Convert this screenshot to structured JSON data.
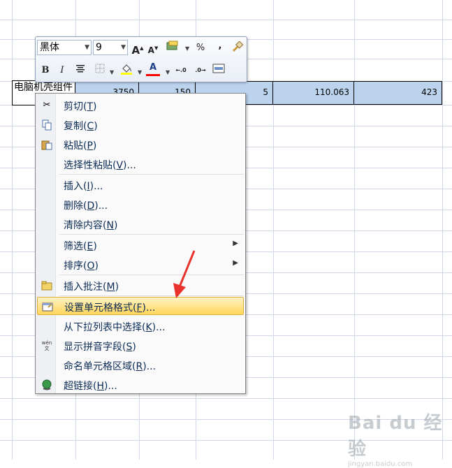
{
  "toolbar": {
    "font_name": "黑体",
    "font_size": "9",
    "icons": [
      "grow-font-icon",
      "shrink-font-icon",
      "number-format-icon",
      "percent-icon",
      "comma-style-icon",
      "format-painter-icon",
      "bold-icon",
      "italic-icon",
      "center-align-icon",
      "borders-icon",
      "fill-color-icon",
      "font-color-icon",
      "increase-decimal-icon",
      "decrease-decimal-icon",
      "merge-center-icon"
    ],
    "percent_label": "%",
    "comma_label": ",",
    "bold_label": "B",
    "italic_label": "I",
    "font_color_label": "A",
    "grow_label": "A",
    "shrink_label": "A",
    "colors": {
      "fill": "#ffff00",
      "font": "#ff0000"
    }
  },
  "row": {
    "name_cell": "电脑机壳组件",
    "values": [
      "3750",
      "150",
      "5",
      "110.063",
      "423"
    ]
  },
  "menu": {
    "items": [
      {
        "text": "剪切(",
        "key": "T",
        "tail": ")",
        "icon": "scissors-icon"
      },
      {
        "text": "复制(",
        "key": "C",
        "tail": ")",
        "icon": "copy-icon"
      },
      {
        "text": "粘贴(",
        "key": "P",
        "tail": ")",
        "icon": "paste-icon"
      },
      {
        "text": "选择性粘贴(",
        "key": "V",
        "tail": ")...",
        "icon": ""
      },
      {
        "text": "插入(",
        "key": "I",
        "tail": ")...",
        "icon": ""
      },
      {
        "text": "删除(",
        "key": "D",
        "tail": ")...",
        "icon": ""
      },
      {
        "text": "清除内容(",
        "key": "N",
        "tail": ")",
        "icon": ""
      },
      {
        "text": "筛选(",
        "key": "E",
        "tail": ")",
        "icon": ""
      },
      {
        "text": "排序(",
        "key": "O",
        "tail": ")",
        "icon": ""
      },
      {
        "text": "插入批注(",
        "key": "M",
        "tail": ")",
        "icon": "comment-icon"
      },
      {
        "text": "设置单元格格式(",
        "key": "F",
        "tail": ")...",
        "icon": "format-cells-icon"
      },
      {
        "text": "从下拉列表中选择(",
        "key": "K",
        "tail": ")...",
        "icon": ""
      },
      {
        "text": "显示拼音字段(",
        "key": "S",
        "tail": ")",
        "icon": "phonetic-icon"
      },
      {
        "text": "命名单元格区域(",
        "key": "R",
        "tail": ")...",
        "icon": ""
      },
      {
        "text": "超链接(",
        "key": "H",
        "tail": ")...",
        "icon": "hyperlink-icon"
      }
    ],
    "highlighted": "设置单元格格式(F)...",
    "phonetic_glyph": "wén 文"
  },
  "watermark": {
    "logo": "Bai du 经验",
    "url": "jingyan.baidu.com"
  },
  "colors": {
    "highlight": "#ffd65c",
    "selection": "#bcd3ee",
    "arrow": "#e8322b"
  }
}
